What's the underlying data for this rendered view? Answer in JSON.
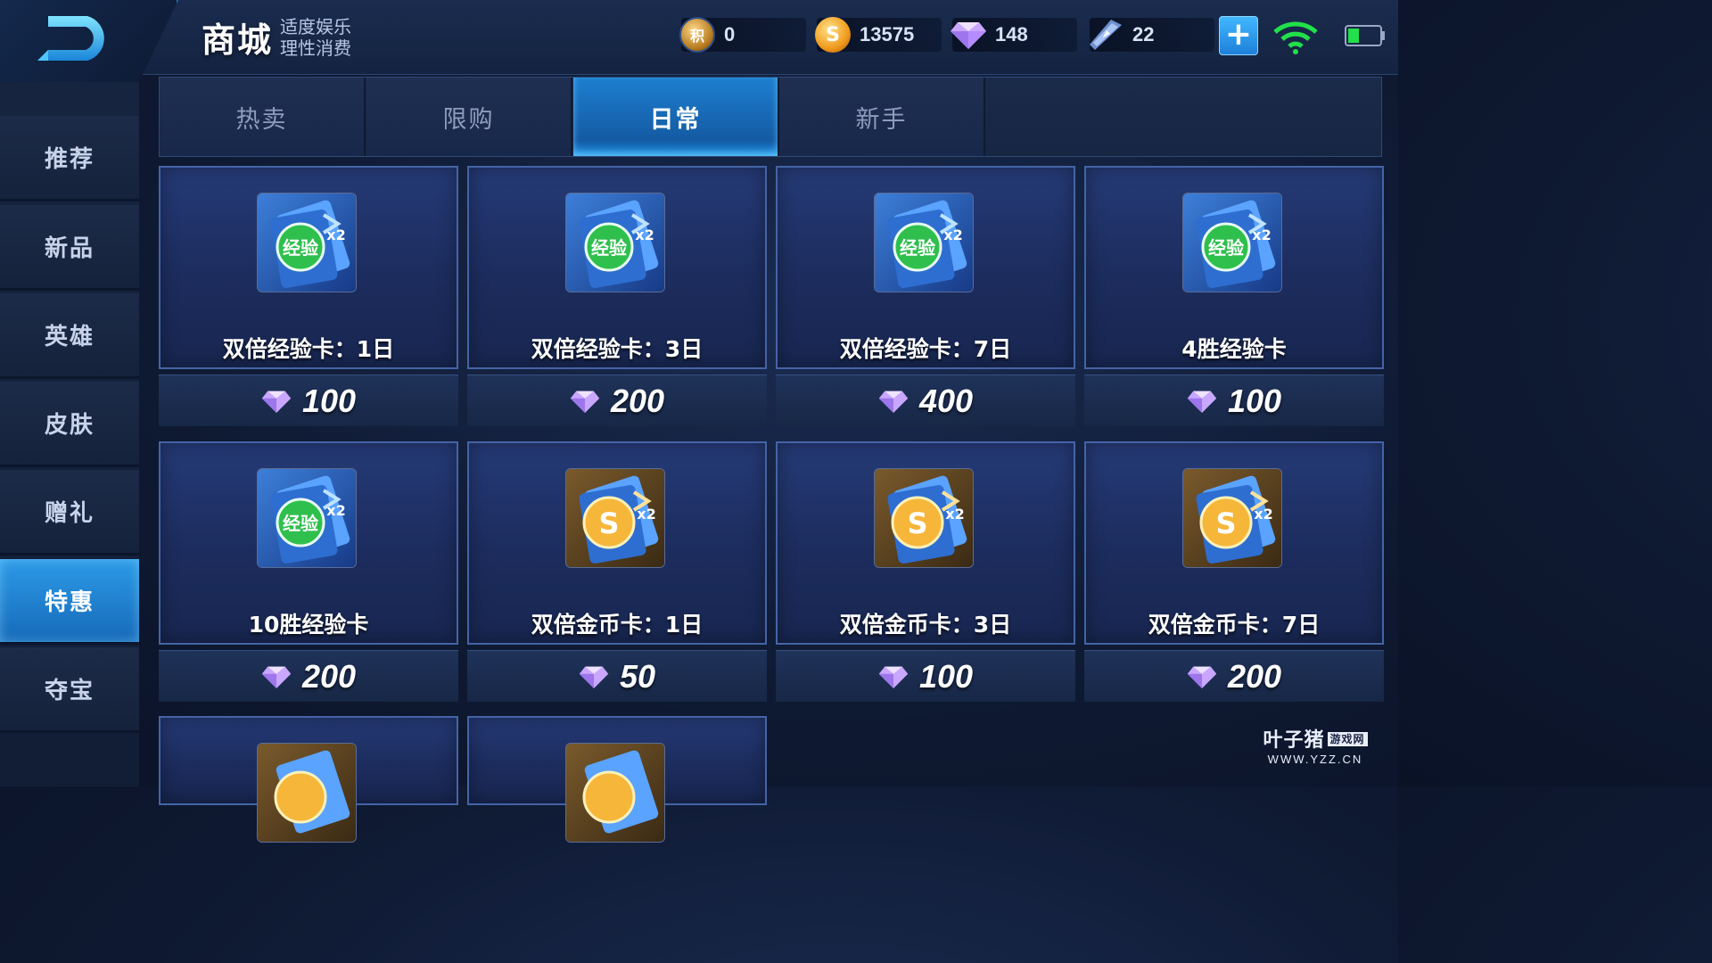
{
  "header": {
    "title": "商城",
    "subtitle_line1": "适度娱乐",
    "subtitle_line2": "理性消费"
  },
  "currencies": {
    "points": {
      "icon": "points-coin-icon",
      "icon_text": "积",
      "value": "0"
    },
    "coins": {
      "icon": "gold-coin-icon",
      "icon_text": "S",
      "value": "13575"
    },
    "gems": {
      "icon": "diamond-icon",
      "value": "148"
    },
    "vouchers": {
      "icon": "voucher-icon",
      "value": "22"
    }
  },
  "sidebar": {
    "items": [
      {
        "label": "推荐",
        "active": false
      },
      {
        "label": "新品",
        "active": false
      },
      {
        "label": "英雄",
        "active": false
      },
      {
        "label": "皮肤",
        "active": false
      },
      {
        "label": "赠礼",
        "active": false
      },
      {
        "label": "特惠",
        "active": true
      },
      {
        "label": "夺宝",
        "active": false
      }
    ]
  },
  "tabs": [
    {
      "label": "热卖",
      "active": false
    },
    {
      "label": "限购",
      "active": false
    },
    {
      "label": "日常",
      "active": true
    },
    {
      "label": "新手",
      "active": false
    }
  ],
  "items": [
    {
      "name": "双倍经验卡：1日",
      "price": "100",
      "icon": "exp-card-icon"
    },
    {
      "name": "双倍经验卡：3日",
      "price": "200",
      "icon": "exp-card-icon"
    },
    {
      "name": "双倍经验卡：7日",
      "price": "400",
      "icon": "exp-card-icon"
    },
    {
      "name": "4胜经验卡",
      "price": "100",
      "icon": "exp-card-icon"
    },
    {
      "name": "10胜经验卡",
      "price": "200",
      "icon": "exp-card-icon"
    },
    {
      "name": "双倍金币卡：1日",
      "price": "50",
      "icon": "gold-card-icon"
    },
    {
      "name": "双倍金币卡：3日",
      "price": "100",
      "icon": "gold-card-icon"
    },
    {
      "name": "双倍金币卡：7日",
      "price": "200",
      "icon": "gold-card-icon"
    }
  ],
  "icon_text": {
    "exp": "经验",
    "multiplier": "x2",
    "gold": "S"
  },
  "watermark": {
    "brand": "叶子猪",
    "tag": "游戏网",
    "url": "WWW.YZZ.CN"
  },
  "colors": {
    "accent_blue": "#1d7fd0",
    "gem_purple": "#b58cff",
    "gold": "#f19a1c"
  }
}
